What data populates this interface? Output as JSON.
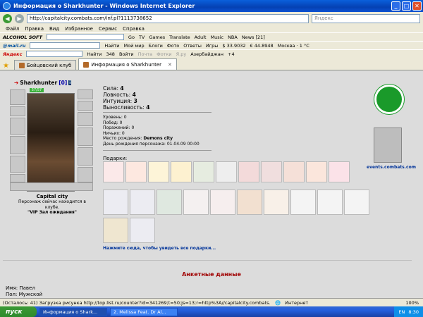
{
  "window": {
    "title": "Информация о Sharkhunter - Windows Internet Explorer",
    "min": "_",
    "max": "□",
    "close": "✕"
  },
  "address": {
    "url": "http://capitalcity.combats.com/inf.pl?1113738652",
    "search_placeholder": "Яндекс"
  },
  "menu": [
    "Файл",
    "Правка",
    "Вид",
    "Избранное",
    "Сервис",
    "Справка"
  ],
  "toolbar1": {
    "brand": "ALCOHOL SOFT",
    "go": "Go",
    "tv": "TV",
    "games": "Games",
    "translate": "Translate",
    "adult": "Adult",
    "music": "Music",
    "nba": "NBA",
    "news": "News [21]"
  },
  "toolbar2": {
    "brand": "@mail.ru",
    "find": "Найти",
    "moi_mir": "Мой мир",
    "blogs": "Блоги",
    "photo": "Фото",
    "answers": "Ответы",
    "games": "Игры",
    "usd": "$ 33.9032",
    "eur": "€ 44.8948",
    "weather": "Москва · 1 °C"
  },
  "toolbar3": {
    "brand": "Яндекс",
    "find": "Найти",
    "count": "348",
    "login": "Войти",
    "mail": "Почта",
    "photos": "Фотки",
    "ya_ru": "Я.ру",
    "region": "Азербайджан",
    "temp": "+4"
  },
  "tabs": [
    {
      "label": "Бойцовский клуб",
      "active": false
    },
    {
      "label": "Информация о Sharkhunter",
      "active": true
    }
  ],
  "character": {
    "name": "Sharkhunter",
    "level": "[0]",
    "info_icon": "i",
    "hp": "57/57",
    "city": "Capital city",
    "location_text": "Персонаж сейчас находится в клубе.",
    "location_room": "\"VIP Зал ожидания\""
  },
  "stats": {
    "sila_label": "Сила:",
    "sila": "4",
    "lovkost_label": "Ловкость:",
    "lovkost": "4",
    "intuition_label": "Интуиция:",
    "intuition": "3",
    "vynosl_label": "Выносливость:",
    "vynosl": "4"
  },
  "record": {
    "level_label": "Уровень:",
    "level": "0",
    "wins_label": "Побед:",
    "wins": "0",
    "losses_label": "Поражений:",
    "losses": "0",
    "draws_label": "Ничьих:",
    "draws": "0",
    "birthplace_label": "Место рождения:",
    "birthplace": "Demons city",
    "birthday_label": "День рождения персонажа:",
    "birthday": "01.04.09 00:00"
  },
  "gifts": {
    "label": "Подарки:",
    "row1_count": 11,
    "row2_count": 10,
    "row3_count": 2,
    "see_more": "Нажмите сюда, чтобы увидеть все подарки..."
  },
  "anketa": {
    "title": "Анкетные данные",
    "name_label": "Имя:",
    "name": "Павел",
    "sex_label": "Пол:",
    "sex": "Мужской"
  },
  "sidebar": {
    "events_link": "events.combats.com"
  },
  "status": {
    "text": "(Осталось: 41) Загрузка рисунка http://top.list.ru/counter?id=341269;t=50;js=13;r=http%3A//capitalcity.combats.com/main.pl%3Ffr",
    "zone": "Интернет",
    "zoom": "100%"
  },
  "taskbar": {
    "start": "пуск",
    "tasks": [
      "Информация о Shark...",
      "2. Melissa Feat. Dr Al..."
    ],
    "lang": "EN",
    "time": "8:30"
  },
  "colors": {
    "accent_red": "#a00000",
    "link_blue": "#003399",
    "hp_green": "#3cb23c",
    "badge_green": "#1a9a2a"
  }
}
